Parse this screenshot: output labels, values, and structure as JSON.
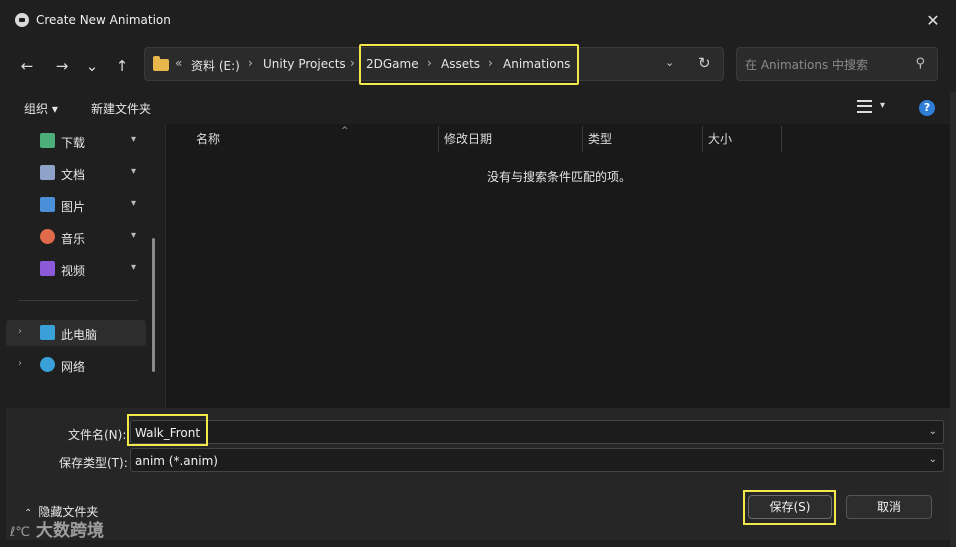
{
  "window": {
    "title": "Create New Animation",
    "close_glyph": "✕"
  },
  "nav": {
    "back": "←",
    "forward": "→",
    "recent": "⌄",
    "up": "↑",
    "address": {
      "overflow": "«",
      "segments": [
        "资料 (E:)",
        "Unity Projects",
        "2DGame",
        "Assets",
        "Animations"
      ],
      "separator": "›",
      "dropdown": "⌄",
      "refresh": "↻"
    },
    "search": {
      "placeholder": "在 Animations 中搜索",
      "icon": "search-icon"
    }
  },
  "toolbar": {
    "organize": "组织 ▾",
    "new_folder": "新建文件夹",
    "view_caret": "▾",
    "help": "?"
  },
  "sidebar": {
    "quick_access": [
      {
        "label": "下载",
        "icon": "download-icon",
        "color": "#4caf7a"
      },
      {
        "label": "文档",
        "icon": "document-icon",
        "color": "#8fa3c8"
      },
      {
        "label": "图片",
        "icon": "pictures-icon",
        "color": "#4a8fd8"
      },
      {
        "label": "音乐",
        "icon": "music-icon",
        "color": "#e06a4a"
      },
      {
        "label": "视频",
        "icon": "video-icon",
        "color": "#8a5ad8"
      }
    ],
    "pin_glyph": "📌",
    "expand_glyph": "›",
    "tree": [
      {
        "label": "此电脑",
        "icon": "computer-icon",
        "color": "#3aa0d8"
      },
      {
        "label": "网络",
        "icon": "network-icon",
        "color": "#3aa0d8"
      }
    ]
  },
  "list": {
    "sort_caret": "^",
    "columns": [
      "名称",
      "修改日期",
      "类型",
      "大小"
    ],
    "empty_message": "没有与搜索条件匹配的项。"
  },
  "form": {
    "filename_label": "文件名(N):",
    "filename_value": "Walk_Front",
    "filetype_label": "保存类型(T):",
    "filetype_value": "anim (*.anim)",
    "dropdown_caret": "⌄",
    "save": "保存(S)",
    "cancel": "取消",
    "hide_folders": "隐藏文件夹",
    "hide_glyph": "⌃"
  },
  "watermark": {
    "logo": "ℓ℃",
    "text": "大数跨境"
  },
  "colors": {
    "highlight": "#f2e84b",
    "accent": "#2f7fd8",
    "folder": "#e8b64a"
  }
}
